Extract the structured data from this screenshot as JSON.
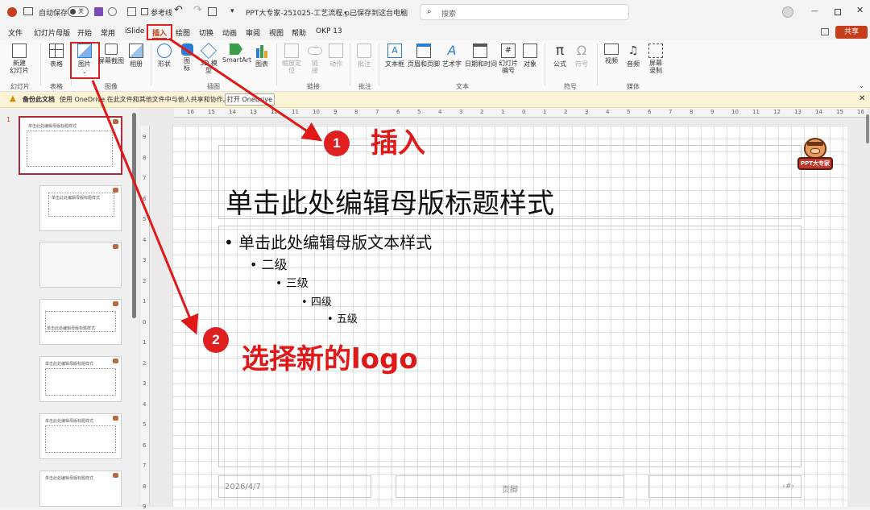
{
  "titlebar": {
    "autosave_label": "自动保存",
    "autosave_state": "关",
    "guides_label": "参考线",
    "doc_title": "PPT大专家-251025-工艺流程.p...",
    "save_status": "• 已保存到这台电脑",
    "search_placeholder": "搜索"
  },
  "menu": {
    "items": [
      "文件",
      "幻灯片母版",
      "开始",
      "常用",
      "iSlide",
      "插入",
      "绘图",
      "切换",
      "动画",
      "审阅",
      "视图",
      "帮助",
      "OKP 13"
    ],
    "active": "插入",
    "share_label": "共享"
  },
  "ribbon": {
    "buttons": {
      "new_slide": "新建\n幻灯片",
      "table": "表格",
      "picture": "图片",
      "screenshot": "屏幕截图",
      "album": "相册",
      "shapes": "形状",
      "icons": "图\n标",
      "model3d": "3D 模\n型",
      "smartart": "SmartArt",
      "chart": "图表",
      "zoom": "缩放定\n位",
      "link": "链\n接",
      "action": "动作",
      "comment": "批注",
      "textbox": "文本框",
      "header_footer": "页眉和页脚",
      "wordart": "艺术字",
      "datetime": "日期和时间",
      "slide_number": "幻灯片\n编号",
      "object": "对象",
      "equation": "公式",
      "symbol": "符号",
      "video": "视频",
      "audio": "音频",
      "screen_record": "屏幕\n录制"
    },
    "groups": {
      "slides": "幻灯片",
      "tables": "表格",
      "images": "图像",
      "illustrations": "插图",
      "links": "链接",
      "comments": "批注",
      "text": "文本",
      "symbols": "符号",
      "media": "媒体"
    }
  },
  "infobar": {
    "title": "备份此文档",
    "message": "使用 OneDrive 在此文件和其他文件中与他人共享和协作。",
    "button": "打开 OneDrive"
  },
  "ruler_h": [
    "16",
    "15",
    "14",
    "13",
    "12",
    "11",
    "10",
    "9",
    "8",
    "7",
    "6",
    "5",
    "4",
    "3",
    "2",
    "1",
    "0",
    "1",
    "2",
    "3",
    "4",
    "5",
    "6",
    "7",
    "8",
    "9",
    "10",
    "11",
    "12",
    "13",
    "14",
    "15",
    "16"
  ],
  "ruler_v": [
    "9",
    "8",
    "7",
    "6",
    "5",
    "4",
    "3",
    "2",
    "1",
    "0",
    "1",
    "2",
    "3",
    "4",
    "5",
    "6",
    "7",
    "8",
    "9"
  ],
  "thumbnails": {
    "number": "1",
    "t1": "单击此处编辑母版标题样式",
    "t2": "单击此处编辑母版标题样式",
    "t4": "单击此处编辑母版标题样式",
    "t5": "单击此处编辑母版标题样式",
    "t6": "单击此处编辑母版标题样式",
    "t7": "单击此处编辑母版标题样式"
  },
  "slide": {
    "title": "单击此处编辑母版标题样式",
    "levels": [
      "单击此处编辑母版文本样式",
      "二级",
      "三级",
      "四级",
      "五级"
    ],
    "date": "2026/4/7",
    "footer": "页脚",
    "page_num": "‹#›",
    "logo_text": "PPT大专家"
  },
  "annotations": {
    "step1_num": "1",
    "step1_text": "插入",
    "step2_num": "2",
    "step2_text": "选择新的logo"
  },
  "colors": {
    "accent": "#c43e1c",
    "annotation": "#e01818",
    "highlight_box": "#e02020"
  }
}
